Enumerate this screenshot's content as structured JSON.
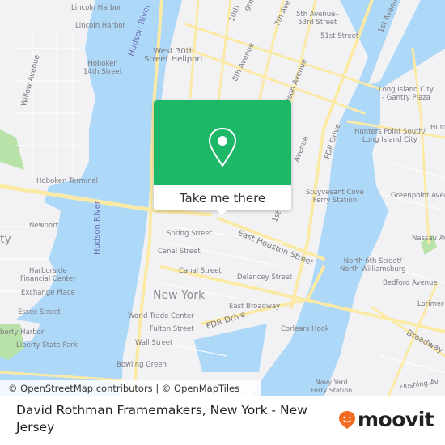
{
  "map": {
    "labels": {
      "lincoln_harbor_1": "Lincoln Harbor",
      "lincoln_harbor_2": "Lincoln Harbor",
      "hoboken_14th": "Hoboken\n14th Street",
      "willow_avenue": "Willow Avenue",
      "hoboken_terminal": "Hoboken Terminal",
      "hudson_river_top": "Hudson River",
      "hudson_river_mid": "Hudson River",
      "west_30th": "West 30th\nStreet Heliport",
      "tenth_ave": "10th",
      "ninth_ave": "9th",
      "seventh_ave": "7th Ave",
      "eighth_ave": "8th Avenue",
      "madison_ave": "Madison Avenue",
      "fifth_ave_53rd": "5th Avenue–\n53rd Street",
      "fifty_first": "51st Street",
      "first_ave_top": "1st Avenue",
      "lic_gantry": "Long Island City\n- Gantry Plaza",
      "hunters_point": "Hunters Point South/\nLong Island City",
      "hunters_right": "Hunt",
      "fdr_drive_top": "FDR Drive",
      "avenue_a": "Avenue",
      "stuyvesant": "Stuyvesant Cove\nFerry Station",
      "greenpoint": "Greenpoint Avenue",
      "nassau": "Nassau Av",
      "east_houston": "East Houston Street",
      "first_st": "1st",
      "north_6th": "North 6th Street/\nNorth Williamsburg",
      "bedford": "Bedford Avenue",
      "lorimer": "Lorimer",
      "delancey": "Delancey Street",
      "east_broadway": "East Broadway",
      "fdr_drive_bottom": "FDR Drive",
      "corlears": "Corlears Hook",
      "broadway": "Broadway",
      "newport": "Newport",
      "jersey_city": "ty",
      "harborside": "Harborside\nFinancial Center",
      "exchange_place": "Exchange Place",
      "essex": "Essex Street",
      "liberty_harbor": "berty Harbor",
      "liberty_state_park": "Liberty State Park",
      "spring": "Spring Street",
      "canal_1": "Canal Street",
      "canal_2": "Canal Street",
      "new_york": "New York",
      "wtc": "World Trade Center",
      "fulton": "Fulton Street",
      "wall": "Wall Street",
      "bowling_green": "Bowling Green",
      "navy_yard": "Navy Yard\nFerry Station",
      "flushing": "Flushing Av"
    },
    "colors": {
      "land": "#f2f2f4",
      "water": "#aed8f8",
      "road": "#fbe9a6",
      "park": "#b9e2a8"
    }
  },
  "popup": {
    "action_label": "Take me there",
    "icon": "map-pin-icon",
    "accent": "#1db768"
  },
  "attribution": "© OpenStreetMap contributors | © OpenMapTiles",
  "footer": {
    "title": "David Rothman Framemakers, New York - New Jersey",
    "brand": "moovit",
    "brand_color": "#f26d21"
  }
}
